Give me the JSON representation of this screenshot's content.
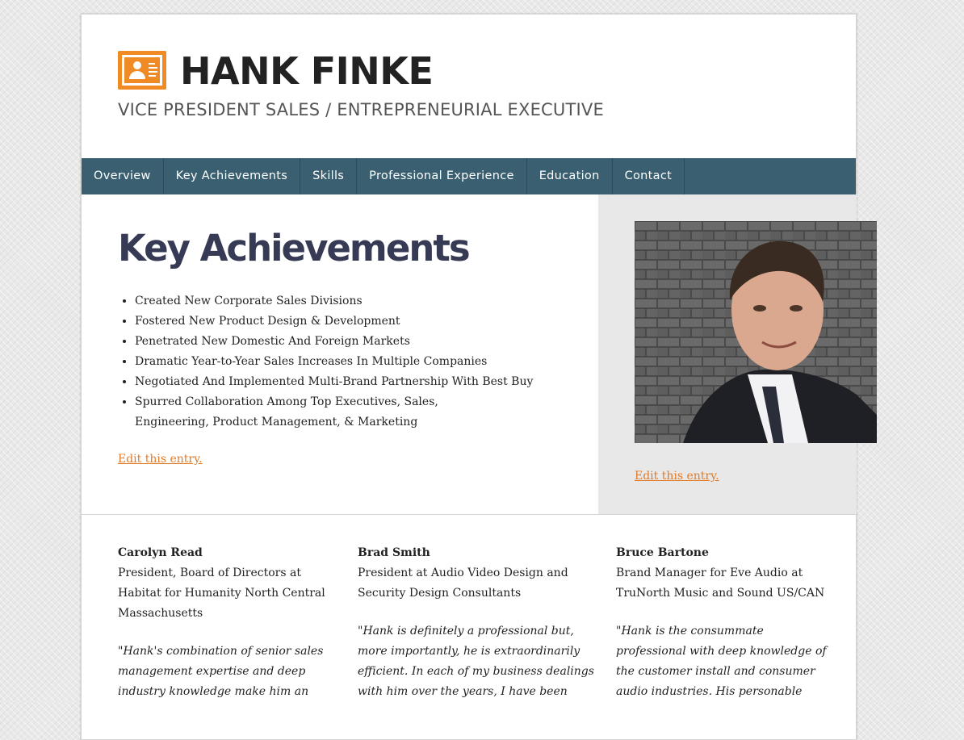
{
  "header": {
    "title": "HANK FINKE",
    "description": "VICE PRESIDENT SALES / ENTREPRENEURIAL EXECUTIVE",
    "accent": "#f08a24"
  },
  "nav": {
    "items": [
      "Overview",
      "Key Achievements",
      "Skills",
      "Professional Experience",
      "Education",
      "Contact"
    ],
    "background": "#3a5f70"
  },
  "main": {
    "title": "Key Achievements",
    "achievements": [
      "Created New Corporate Sales Divisions",
      "Fostered New Product Design & Development",
      "Penetrated New Domestic And Foreign Markets",
      "Dramatic Year-to-Year Sales Increases In Multiple Companies",
      "Negotiated And Implemented Multi-Brand Partnership With Best Buy",
      "Spurred Collaboration Among Top Executives, Sales, Engineering, Product Management, & Marketing"
    ],
    "edit_label": "Edit this entry."
  },
  "sidebar": {
    "edit_label": "Edit this entry."
  },
  "testimonials": [
    {
      "name": "Carolyn Read",
      "role_lines": [
        "President, Board of Directors at",
        "Habitat for Humanity North Central",
        "Massachusetts"
      ],
      "quote_lines": [
        "\"Hank's combination of senior sales",
        "management expertise and deep",
        "industry knowledge make him an"
      ]
    },
    {
      "name": "Brad Smith",
      "role_lines": [
        "President at Audio Video Design and",
        "Security Design Consultants"
      ],
      "quote_lines": [
        "\"Hank is definitely a professional but,",
        "more importantly, he is extraordinarily",
        "efficient. In each of my business dealings",
        "with him over the years, I have been"
      ]
    },
    {
      "name": "Bruce Bartone",
      "role_lines": [
        "Brand Manager for Eve Audio at",
        "TruNorth Music and Sound US/CAN"
      ],
      "quote_lines": [
        "\"Hank is the consummate",
        "professional with deep knowledge of",
        "the customer install and consumer",
        "audio industries. His personable"
      ]
    }
  ]
}
